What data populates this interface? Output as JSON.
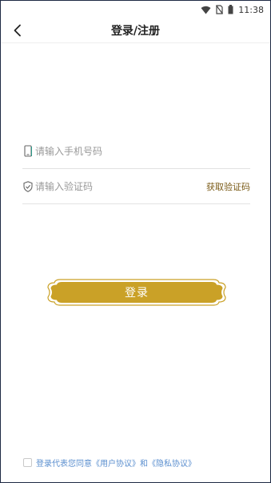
{
  "status_bar": {
    "time": "11:38",
    "icons": [
      "wifi-icon",
      "no-sim-icon",
      "battery-icon"
    ]
  },
  "header": {
    "title": "登录/注册",
    "back_icon": "chevron-left-icon"
  },
  "form": {
    "phone": {
      "placeholder": "请输入手机号码",
      "value": "",
      "icon": "phone-icon"
    },
    "code": {
      "placeholder": "请输入验证码",
      "value": "",
      "icon": "shield-check-icon",
      "get_code_label": "获取验证码"
    }
  },
  "login_button": {
    "label": "登录",
    "color": "#caa127"
  },
  "agreement": {
    "prefix": "登录代表您同意",
    "user_agreement": "《用户协议》",
    "joiner": "和",
    "privacy_agreement": "《隐私协议》",
    "checked": false
  },
  "colors": {
    "accent_gold": "#caa127",
    "link_blue": "#5b8fcf",
    "code_link": "#7a5a16"
  }
}
